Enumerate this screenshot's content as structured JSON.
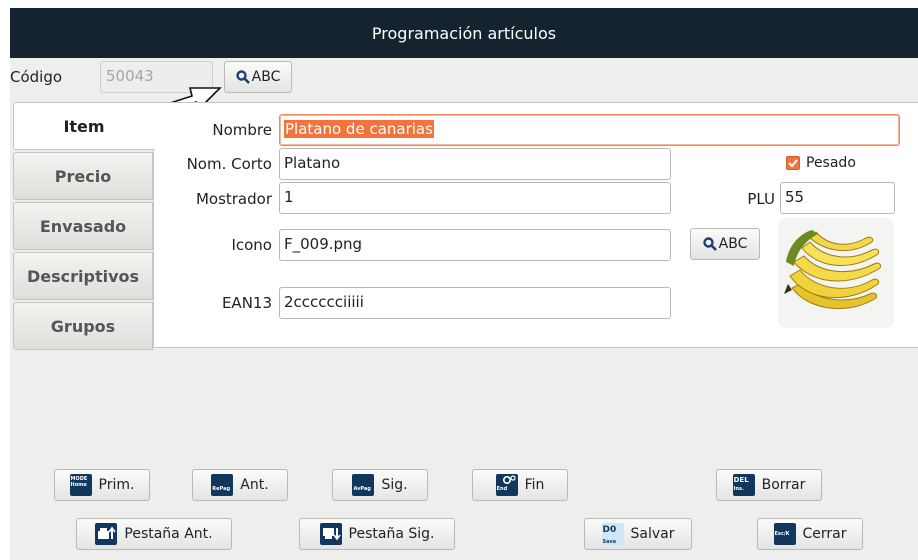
{
  "window": {
    "title": "Programación artículos"
  },
  "codigo": {
    "label": "Código",
    "value": "50043",
    "search_button": "ABC"
  },
  "tabs": [
    {
      "label": "Item",
      "active": true
    },
    {
      "label": "Precio",
      "active": false
    },
    {
      "label": "Envasado",
      "active": false
    },
    {
      "label": "Descriptivos",
      "active": false
    },
    {
      "label": "Grupos",
      "active": false
    }
  ],
  "form": {
    "nombre": {
      "label": "Nombre",
      "value": "Platano de canarias"
    },
    "nom_corto": {
      "label": "Nom. Corto",
      "value": "Platano"
    },
    "mostrador": {
      "label": "Mostrador",
      "value": "1"
    },
    "icono": {
      "label": "Icono",
      "value": "F_009.png",
      "search_button": "ABC"
    },
    "ean13": {
      "label": "EAN13",
      "value": "2cccccciiiii"
    },
    "pesado": {
      "label": "Pesado",
      "checked": true
    },
    "plu": {
      "label": "PLU",
      "value": "55"
    }
  },
  "toolbar": {
    "prim": {
      "label": "Prim.",
      "icon_text_1": "MODE",
      "icon_text_2": "Home"
    },
    "ant": {
      "label": "Ant.",
      "icon_text": "RePag"
    },
    "sig": {
      "label": "Sig.",
      "icon_text": "AvPag"
    },
    "fin": {
      "label": "Fin",
      "icon_text": "End"
    },
    "borrar": {
      "label": "Borrar",
      "icon_text_1": "DEL",
      "icon_text_2": "Ins."
    },
    "pestana_ant": {
      "label": "Pestaña Ant."
    },
    "pestana_sig": {
      "label": "Pestaña Sig."
    },
    "salvar": {
      "label": "Salvar",
      "icon_text_1": "D0",
      "icon_text_2": "Save"
    },
    "cerrar": {
      "label": "Cerrar",
      "icon_text": "Esc/K"
    }
  },
  "colors": {
    "title_bar": "#152230",
    "accent": "#f2743c",
    "button_icon": "#12375e"
  },
  "icons": [
    "search-icon",
    "arrow-annotation",
    "banana-image",
    "checkbox-icon"
  ]
}
